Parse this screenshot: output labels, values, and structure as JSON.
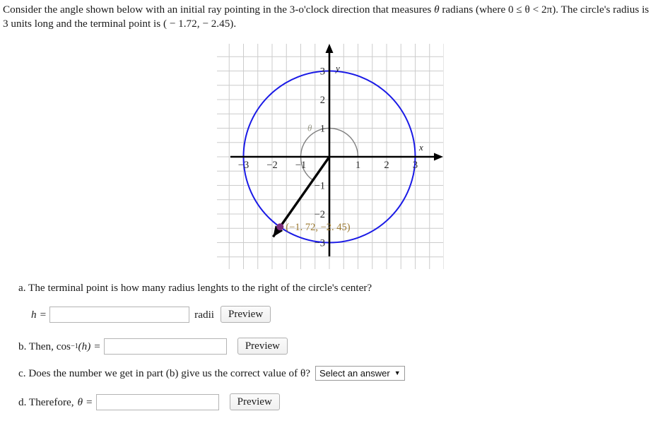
{
  "prompt": {
    "line1_a": "Consider the angle shown below with an initial ray pointing in the 3-o'clock direction that measures ",
    "theta_sym": "θ",
    "line1_b": " radians (where 0 ≤ θ < 2π). The circle's",
    "line2_a": "radius is 3 units long and the terminal point is ",
    "point_text": "( − 1.72,  − 2.45)",
    "line2_b": "."
  },
  "chart_data": {
    "type": "scatter",
    "title": "",
    "xlabel": "x",
    "ylabel": "y",
    "xlim": [
      -3.9,
      3.9
    ],
    "ylim": [
      -3.9,
      3.9
    ],
    "xticks": [
      -3,
      -2,
      -1,
      1,
      2,
      3
    ],
    "yticks": [
      3,
      2,
      1,
      -1,
      -2,
      -3
    ],
    "xtick_labels": [
      "−3",
      "−2",
      "−1",
      "1",
      "2",
      "3"
    ],
    "ytick_labels": [
      "3",
      "2",
      "1",
      "−1",
      "−2",
      "−3"
    ],
    "grid": true,
    "grid_step": 0.5,
    "circle": {
      "center": [
        0,
        0
      ],
      "radius": 3,
      "color": "#1a1ae6"
    },
    "angle_arc": {
      "label": "θ",
      "radius": 1.0,
      "start_deg": 0,
      "end_deg": 235,
      "direction": "counterclockwise",
      "color": "#808080"
    },
    "terminal_ray": {
      "from": [
        0,
        0
      ],
      "through": [
        -1.72,
        -2.45
      ],
      "arrow": true,
      "color": "#000000"
    },
    "points": [
      {
        "x": -1.72,
        "y": -2.45,
        "label": "(−1. 72,  −2. 45)",
        "color": "#7b2d7b",
        "label_color": "#9c7a33"
      }
    ],
    "axis_color": "#000000",
    "gridline_color": "#cccccc",
    "ticklabel_color": "#2a2a2a"
  },
  "questions": {
    "a": {
      "text": "a. The terminal point is how many radius lenghts to the right of the circle's center?",
      "var_label": "h",
      "equals": "=",
      "input_value": "",
      "input_placeholder": "",
      "unit": "radii",
      "preview_label": "Preview"
    },
    "b": {
      "prefix": "b. Then, cos",
      "superscript": "−1",
      "arg": "(h)",
      "equals": "=",
      "input_value": "",
      "input_placeholder": "",
      "preview_label": "Preview"
    },
    "c": {
      "text": "c. Does the number we get in part (b) give us the correct value of θ?",
      "select_label": "Select an answer",
      "select_caret": "▼"
    },
    "d": {
      "prefix": "d. Therefore,",
      "theta_sym": "θ",
      "equals": "=",
      "input_value": "",
      "input_placeholder": "",
      "preview_label": "Preview"
    }
  }
}
